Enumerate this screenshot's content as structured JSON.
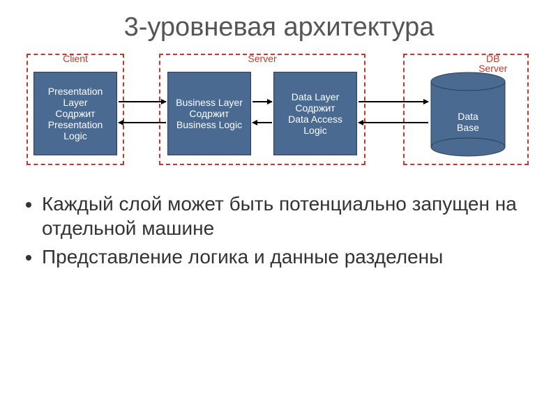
{
  "title": "3-уровневая архитектура",
  "groups": {
    "client": {
      "label": "Client"
    },
    "server": {
      "label": "Server"
    },
    "dbserver": {
      "label": "DB Server"
    }
  },
  "layers": {
    "presentation": "Presentation Layer\nСодржит\nPresentation Logic",
    "business": "Business Layer\nСодржит\nBusiness Logic",
    "data": "Data Layer\nСодржит\nData Access Logic",
    "database": "Data\nBase"
  },
  "bullets": [
    "Каждый слой может быть потенциально запущен на отдельной машине",
    "Представление логика и данные разделены"
  ]
}
